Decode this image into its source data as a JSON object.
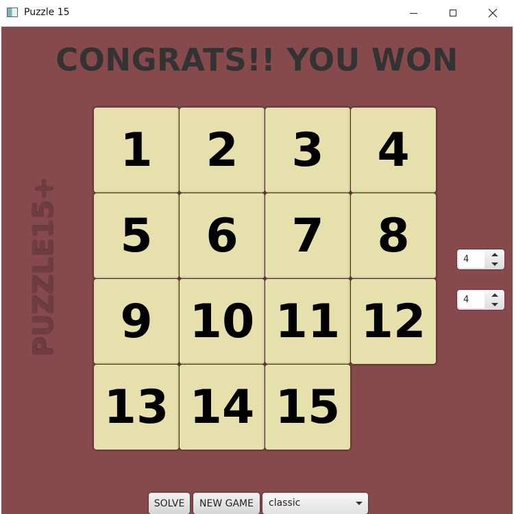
{
  "window": {
    "title": "Puzzle 15",
    "icon": "app-window-icon",
    "controls": [
      "minimize-icon",
      "maximize-icon",
      "close-icon"
    ]
  },
  "game": {
    "status_message": "CONGRATS!! YOU WON",
    "side_logo": "PUZZLE15+",
    "board": {
      "rows": 4,
      "cols": 4,
      "tiles": [
        "1",
        "2",
        "3",
        "4",
        "5",
        "6",
        "7",
        "8",
        "9",
        "10",
        "11",
        "12",
        "13",
        "14",
        "15",
        ""
      ],
      "empty_position": "bottom-right"
    },
    "colors": {
      "background": "#864a4d",
      "tile": "#e6e1ac",
      "headline": "#333333"
    }
  },
  "settings": {
    "rows_spinner_value": "4",
    "cols_spinner_value": "4"
  },
  "controls": {
    "solve_label": "SOLVE",
    "new_game_label": "NEW GAME",
    "mode_selected": "classic"
  }
}
